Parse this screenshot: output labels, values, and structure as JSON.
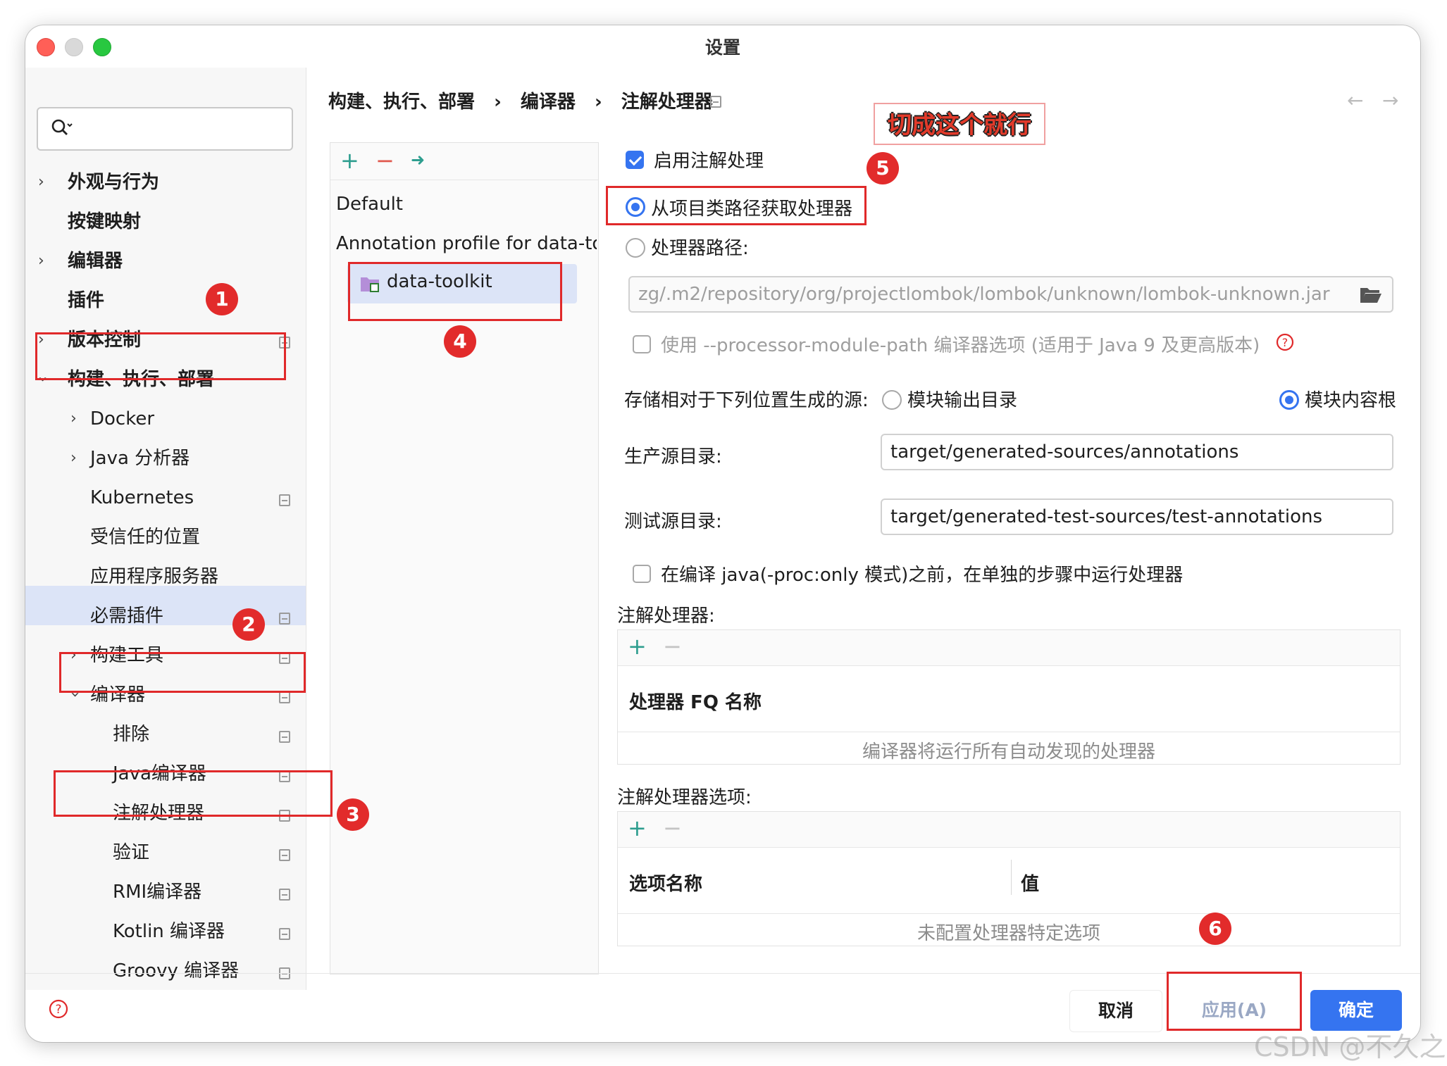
{
  "window": {
    "title": "设置"
  },
  "sidebar": {
    "items": [
      {
        "label": "外观与行为"
      },
      {
        "label": "按键映射"
      },
      {
        "label": "编辑器"
      },
      {
        "label": "插件"
      },
      {
        "label": "版本控制"
      },
      {
        "label": "构建、执行、部署"
      },
      {
        "label": "Docker"
      },
      {
        "label": "Java 分析器"
      },
      {
        "label": "Kubernetes"
      },
      {
        "label": "受信任的位置"
      },
      {
        "label": "应用程序服务器"
      },
      {
        "label": "必需插件"
      },
      {
        "label": "构建工具"
      },
      {
        "label": "编译器"
      },
      {
        "label": "排除"
      },
      {
        "label": "Java编译器"
      },
      {
        "label": "注解处理器"
      },
      {
        "label": "验证"
      },
      {
        "label": "RMI编译器"
      },
      {
        "label": "Kotlin 编译器"
      },
      {
        "label": "Groovy 编译器"
      }
    ]
  },
  "breadcrumb": {
    "parts": [
      "构建、执行、部署",
      "编译器",
      "注解处理器"
    ],
    "separator": "›"
  },
  "nav": {
    "back": "←",
    "forward": "→"
  },
  "profiles": {
    "toolbar": {
      "add": "+",
      "remove": "−",
      "move": "➜"
    },
    "default": "Default",
    "group": "Annotation profile for data-tool",
    "module": "data-toolkit"
  },
  "settings": {
    "enable_label": "启用注解处理",
    "enable_checked": true,
    "from_classpath_label": "从项目类路径获取处理器",
    "processor_path_label": "处理器路径:",
    "processor_path_value": "zg/.m2/repository/org/projectlombok/lombok/unknown/lombok-unknown.jar",
    "module_path_label": "使用 --processor-module-path 编译器选项 (适用于 Java 9 及更高版本)",
    "store_label": "存储相对于下列位置生成的源:",
    "store_opt_output": "模块输出目录",
    "store_opt_content": "模块内容根",
    "prod_label": "生产源目录:",
    "prod_value": "target/generated-sources/annotations",
    "test_label": "测试源目录:",
    "test_value": "target/generated-test-sources/test-annotations",
    "separate_step_label": "在编译 java(-proc:only 模式)之前，在单独的步骤中运行处理器",
    "processors_title": "注解处理器:",
    "processors_header": "处理器 FQ 名称",
    "processors_empty": "编译器将运行所有自动发现的处理器",
    "options_title": "注解处理器选项:",
    "options_col_name": "选项名称",
    "options_col_value": "值",
    "options_empty": "未配置处理器特定选项",
    "add": "+",
    "remove": "−"
  },
  "annotations": {
    "callout": "切成这个就行",
    "badges": [
      "1",
      "2",
      "3",
      "4",
      "5",
      "6"
    ]
  },
  "footer": {
    "help": "?",
    "cancel": "取消",
    "apply": "应用(A)",
    "ok": "确定"
  },
  "watermark": "CSDN @不久之",
  "colors": {
    "accent": "#3574f0",
    "annotation_red": "#e0292a",
    "selection": "#dce4f7"
  }
}
